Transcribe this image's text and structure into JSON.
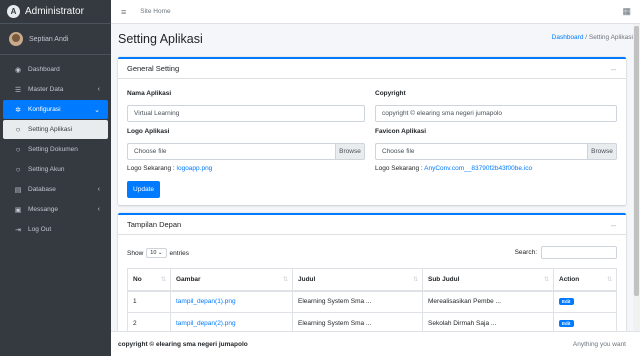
{
  "brand": {
    "title": "Administrator"
  },
  "user": {
    "name": "Septian Andi"
  },
  "sidebar": {
    "items": [
      {
        "label": "Dashboard",
        "icon": "dashboard-icon"
      },
      {
        "label": "Master Data",
        "icon": "database-icon"
      },
      {
        "label": "Konfigurasi",
        "icon": "gear-icon"
      },
      {
        "label": "Setting Aplikasi",
        "icon": "circle-icon"
      },
      {
        "label": "Setting Dokumen",
        "icon": "circle-icon"
      },
      {
        "label": "Setting Akun",
        "icon": "circle-icon"
      },
      {
        "label": "Database",
        "icon": "table-icon"
      },
      {
        "label": "Messange",
        "icon": "message-icon"
      },
      {
        "label": "Log Out",
        "icon": "logout-icon"
      }
    ]
  },
  "topbar": {
    "site_home": "Site Home"
  },
  "page": {
    "title": "Setting Aplikasi",
    "breadcrumb_home": "Dashboard",
    "breadcrumb_sep": "/",
    "breadcrumb_current": "Setting Aplikasi"
  },
  "general": {
    "title": "General Setting",
    "nama_label": "Nama Aplikasi",
    "nama_value": "Virtual Learning",
    "copyright_label": "Copyright",
    "copyright_value": "copyright © elearing sma negeri jumapolo",
    "logo_label": "Logo Aplikasi",
    "logo_file": "Choose file",
    "browse": "Browse",
    "favicon_label": "Favicon Aplikasi",
    "favicon_file": "Choose file",
    "logo_current_prefix": "Logo Sekarang :",
    "logo_current_link": "logoapp.png",
    "favicon_current_prefix": "Logo Sekarang :",
    "favicon_current_link": "AnyConv.com__83790f2b43f00be.ico",
    "update_button": "Update"
  },
  "tampilan": {
    "title": "Tampilan Depan",
    "show_label": "Show",
    "entries_value": "10",
    "entries_label": "entries",
    "search_label": "Search:",
    "columns": [
      "No",
      "Gambar",
      "Judul",
      "Sub Judul",
      "Action"
    ],
    "rows": [
      {
        "no": "1",
        "gambar": "tampil_depan(1).png",
        "judul": "Elearning System Sma ...",
        "sub_judul": "Merealisasikan Pembe ...",
        "action": "Edit"
      },
      {
        "no": "2",
        "gambar": "tampil_depan(2).png",
        "judul": "Elearning System Sma ...",
        "sub_judul": "Sekolah Dirmah Saja ...",
        "action": "Edit"
      }
    ]
  },
  "footer": {
    "copyright": "copyright © elearing sma negeri jumapolo",
    "right": "Anything you want"
  },
  "colors": {
    "accent": "#007bff",
    "sidebar": "#343a40"
  }
}
